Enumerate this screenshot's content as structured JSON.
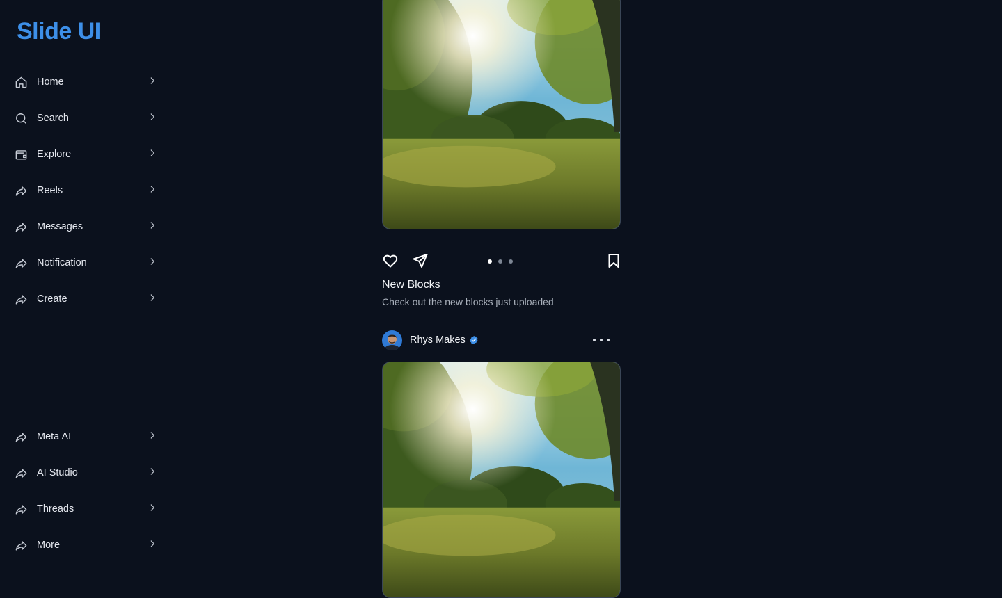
{
  "app": {
    "logo": "Slide UI"
  },
  "sidebar": {
    "top_items": [
      {
        "label": "Home",
        "icon": "home-icon"
      },
      {
        "label": "Search",
        "icon": "search-icon"
      },
      {
        "label": "Explore",
        "icon": "wallet-icon"
      },
      {
        "label": "Reels",
        "icon": "share-arrow-icon"
      },
      {
        "label": "Messages",
        "icon": "share-arrow-icon"
      },
      {
        "label": "Notification",
        "icon": "share-arrow-icon"
      },
      {
        "label": "Create",
        "icon": "share-arrow-icon"
      }
    ],
    "bottom_items": [
      {
        "label": "Meta AI",
        "icon": "share-arrow-icon"
      },
      {
        "label": "AI Studio",
        "icon": "share-arrow-icon"
      },
      {
        "label": "Threads",
        "icon": "share-arrow-icon"
      },
      {
        "label": "More",
        "icon": "share-arrow-icon"
      }
    ]
  },
  "feed": {
    "post1": {
      "title": "New Blocks",
      "description": "Check out the new blocks just uploaded",
      "carousel": {
        "count": 3,
        "active": 1
      }
    },
    "post2": {
      "author": "Rhys Makes",
      "verified": true
    }
  },
  "colors": {
    "background": "#0b111d",
    "accent": "#3d8fe8",
    "verified_badge": "#3d8fe8"
  }
}
